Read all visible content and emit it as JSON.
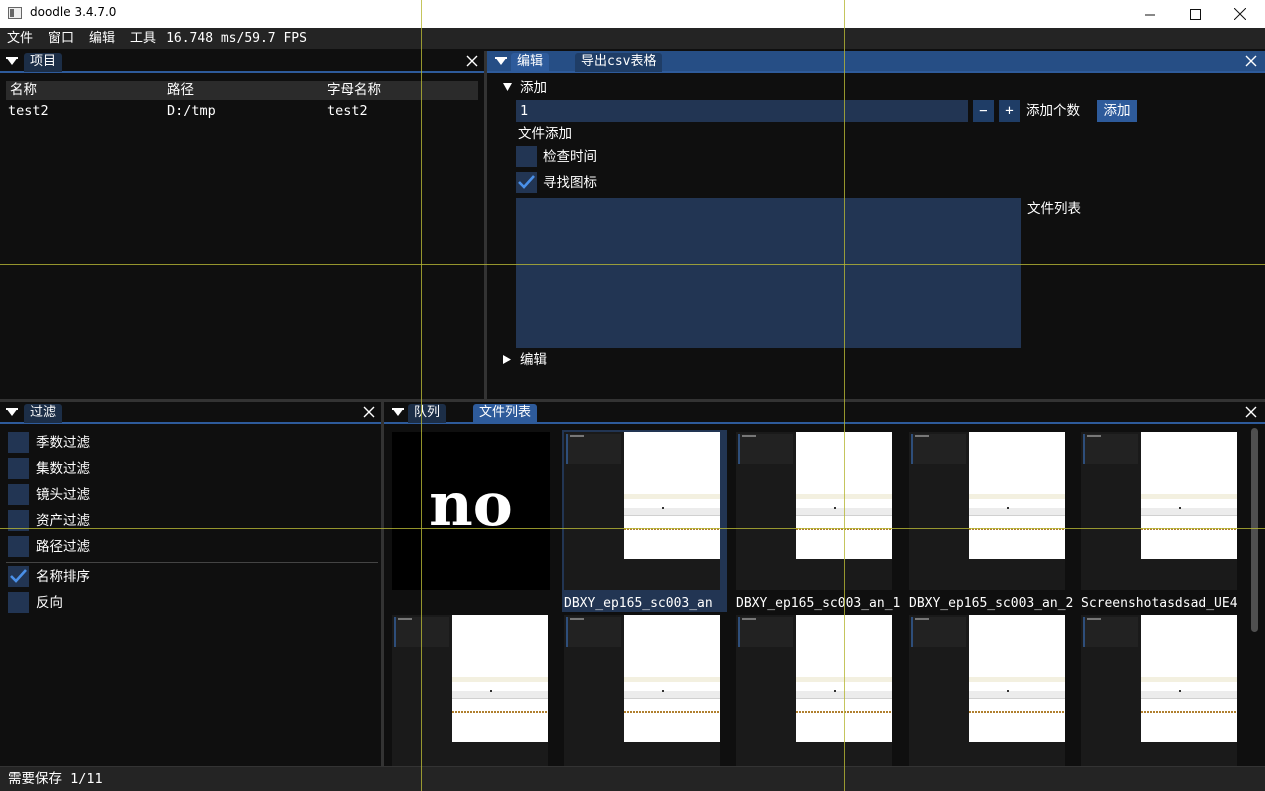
{
  "window": {
    "title": "doodle 3.4.7.0"
  },
  "menubar": {
    "items": [
      "文件",
      "窗口",
      "编辑",
      "工具"
    ],
    "fps": "16.748 ms/59.7 FPS"
  },
  "project_panel": {
    "tab": "项目",
    "columns": [
      "名称",
      "路径",
      "字母名称"
    ],
    "rows": [
      {
        "name": "test2",
        "path": "D:/tmp",
        "letter_name": "test2"
      }
    ]
  },
  "edit_panel": {
    "tabs": [
      "编辑",
      "导出csv表格"
    ],
    "add_section": "添加",
    "count_value": "1",
    "minus": "−",
    "plus": "+",
    "count_label": "添加个数",
    "add_button": "添加",
    "file_add": "文件添加",
    "check_time": {
      "label": "检查时间",
      "checked": false
    },
    "find_icon": {
      "label": "寻找图标",
      "checked": true
    },
    "file_list_label": "文件列表",
    "edit_section": "编辑"
  },
  "filter_panel": {
    "tab": "过滤",
    "filters": [
      {
        "label": "季数过滤",
        "checked": false
      },
      {
        "label": "集数过滤",
        "checked": false
      },
      {
        "label": "镜头过滤",
        "checked": false
      },
      {
        "label": "资产过滤",
        "checked": false
      },
      {
        "label": "路径过滤",
        "checked": false
      }
    ],
    "sorts": [
      {
        "label": "名称排序",
        "checked": true
      },
      {
        "label": "反向",
        "checked": false
      }
    ]
  },
  "file_panel": {
    "tabs": [
      "队列",
      "文件列表"
    ],
    "no_image_text": "no",
    "row1_labels": [
      "",
      "DBXY_ep165_sc003_an",
      "DBXY_ep165_sc003_an_1",
      "DBXY_ep165_sc003_an_2",
      "Screenshotasdsad_UE4"
    ]
  },
  "statusbar": {
    "text": "需要保存 1/11"
  },
  "colors": {
    "accent": "#2e5b9b",
    "check": "#223553",
    "guide": "#b7b734"
  }
}
